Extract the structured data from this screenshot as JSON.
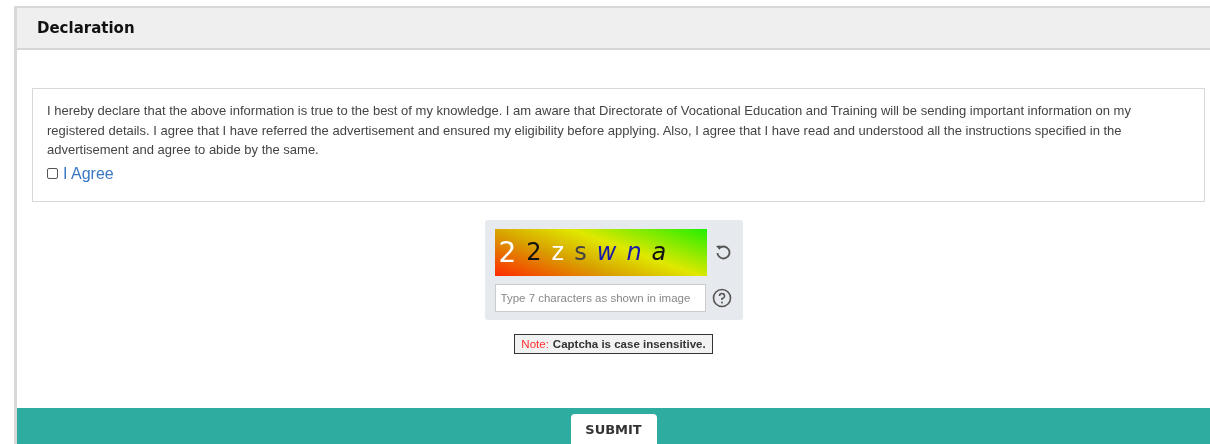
{
  "section": {
    "title": "Declaration"
  },
  "declaration": {
    "text": "I hereby declare that the above information is true to the best of my knowledge. I am aware that Directorate of Vocational Education and Training will be sending important information on my registered details. I agree that I have referred the advertisement and ensured my eligibility before applying. Also, I agree that I have read and understood all the instructions specified in the advertisement and agree to abide by the same.",
    "agree_label": "I Agree",
    "checked": false
  },
  "captcha": {
    "characters": [
      {
        "char": "2",
        "color": "#ffffff"
      },
      {
        "char": "2",
        "color": "#111111"
      },
      {
        "char": "z",
        "color": "#ffffff"
      },
      {
        "char": "s",
        "color": "#444444"
      },
      {
        "char": "w",
        "color": "#1a1aa8"
      },
      {
        "char": "n",
        "color": "#1a1aa8"
      },
      {
        "char": "a",
        "color": "#111111"
      }
    ],
    "placeholder": "Type 7 characters as shown in image"
  },
  "note": {
    "label": "Note:",
    "text": "Captcha is case insensitive."
  },
  "submit": "SUBMIT"
}
